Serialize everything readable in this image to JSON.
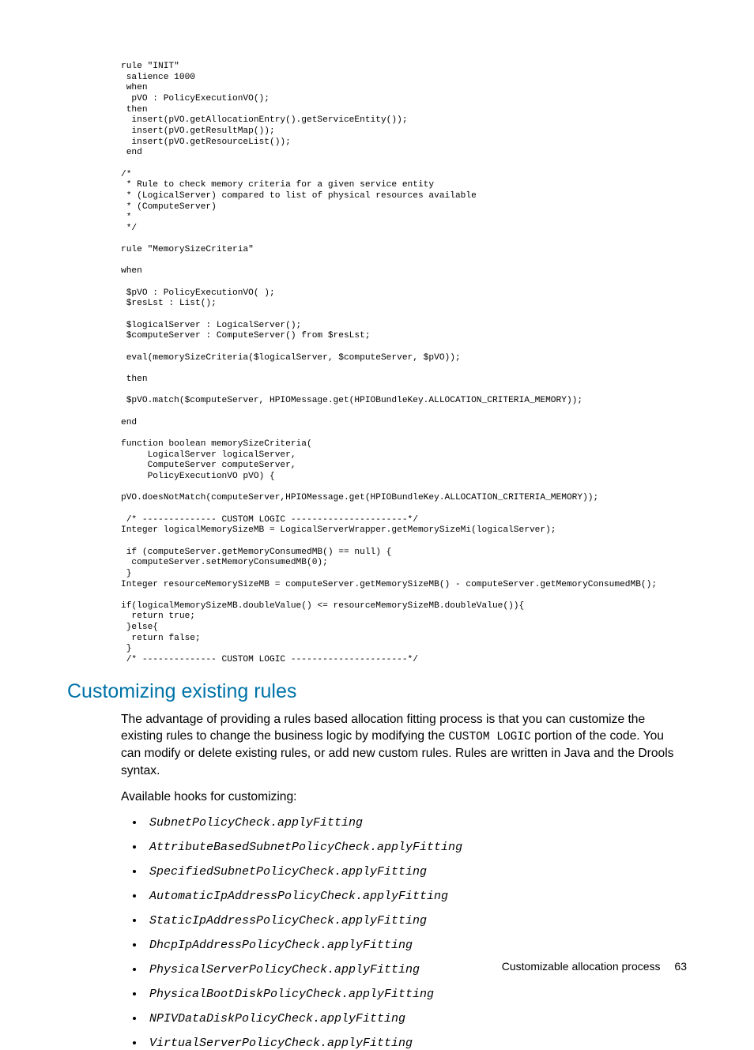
{
  "code_block": "rule \"INIT\"\n salience 1000\n when\n  pVO : PolicyExecutionVO();\n then\n  insert(pVO.getAllocationEntry().getServiceEntity());\n  insert(pVO.getResultMap());\n  insert(pVO.getResourceList());\n end\n\n/*\n * Rule to check memory criteria for a given service entity\n * (LogicalServer) compared to list of physical resources available\n * (ComputeServer)\n *\n */\n\nrule \"MemorySizeCriteria\"\n\nwhen\n\n $pVO : PolicyExecutionVO( );\n $resLst : List();\n\n $logicalServer : LogicalServer();\n $computeServer : ComputeServer() from $resLst;\n\n eval(memorySizeCriteria($logicalServer, $computeServer, $pVO));\n\n then\n\n $pVO.match($computeServer, HPIOMessage.get(HPIOBundleKey.ALLOCATION_CRITERIA_MEMORY));\n\nend\n\nfunction boolean memorySizeCriteria(\n     LogicalServer logicalServer,\n     ComputeServer computeServer,\n     PolicyExecutionVO pVO) {\n\npVO.doesNotMatch(computeServer,HPIOMessage.get(HPIOBundleKey.ALLOCATION_CRITERIA_MEMORY));\n\n /* -------------- CUSTOM LOGIC ----------------------*/\nInteger logicalMemorySizeMB = LogicalServerWrapper.getMemorySizeMi(logicalServer);\n\n if (computeServer.getMemoryConsumedMB() == null) {\n  computeServer.setMemoryConsumedMB(0);\n }\nInteger resourceMemorySizeMB = computeServer.getMemorySizeMB() - computeServer.getMemoryConsumedMB();\n\nif(logicalMemorySizeMB.doubleValue() <= resourceMemorySizeMB.doubleValue()){\n  return true;\n }else{\n  return false;\n }\n /* -------------- CUSTOM LOGIC ----------------------*/",
  "heading": "Customizing existing rules",
  "para1_a": "The advantage of providing a rules based allocation fitting process is that you can customize the existing rules to change the business logic by modifying the ",
  "para1_code": "CUSTOM LOGIC",
  "para1_b": " portion of the code. You can modify or delete existing rules, or add new custom rules. Rules are written in Java and the Drools syntax.",
  "para2": "Available hooks for customizing:",
  "hooks": [
    "SubnetPolicyCheck.applyFitting",
    "AttributeBasedSubnetPolicyCheck.applyFitting",
    "SpecifiedSubnetPolicyCheck.applyFitting",
    "AutomaticIpAddressPolicyCheck.applyFitting",
    "StaticIpAddressPolicyCheck.applyFitting",
    "DhcpIpAddressPolicyCheck.applyFitting",
    "PhysicalServerPolicyCheck.applyFitting",
    "PhysicalBootDiskPolicyCheck.applyFitting",
    "NPIVDataDiskPolicyCheck.applyFitting",
    "VirtualServerPolicyCheck.applyFitting"
  ],
  "footer_text": "Customizable allocation process",
  "page_number": "63"
}
